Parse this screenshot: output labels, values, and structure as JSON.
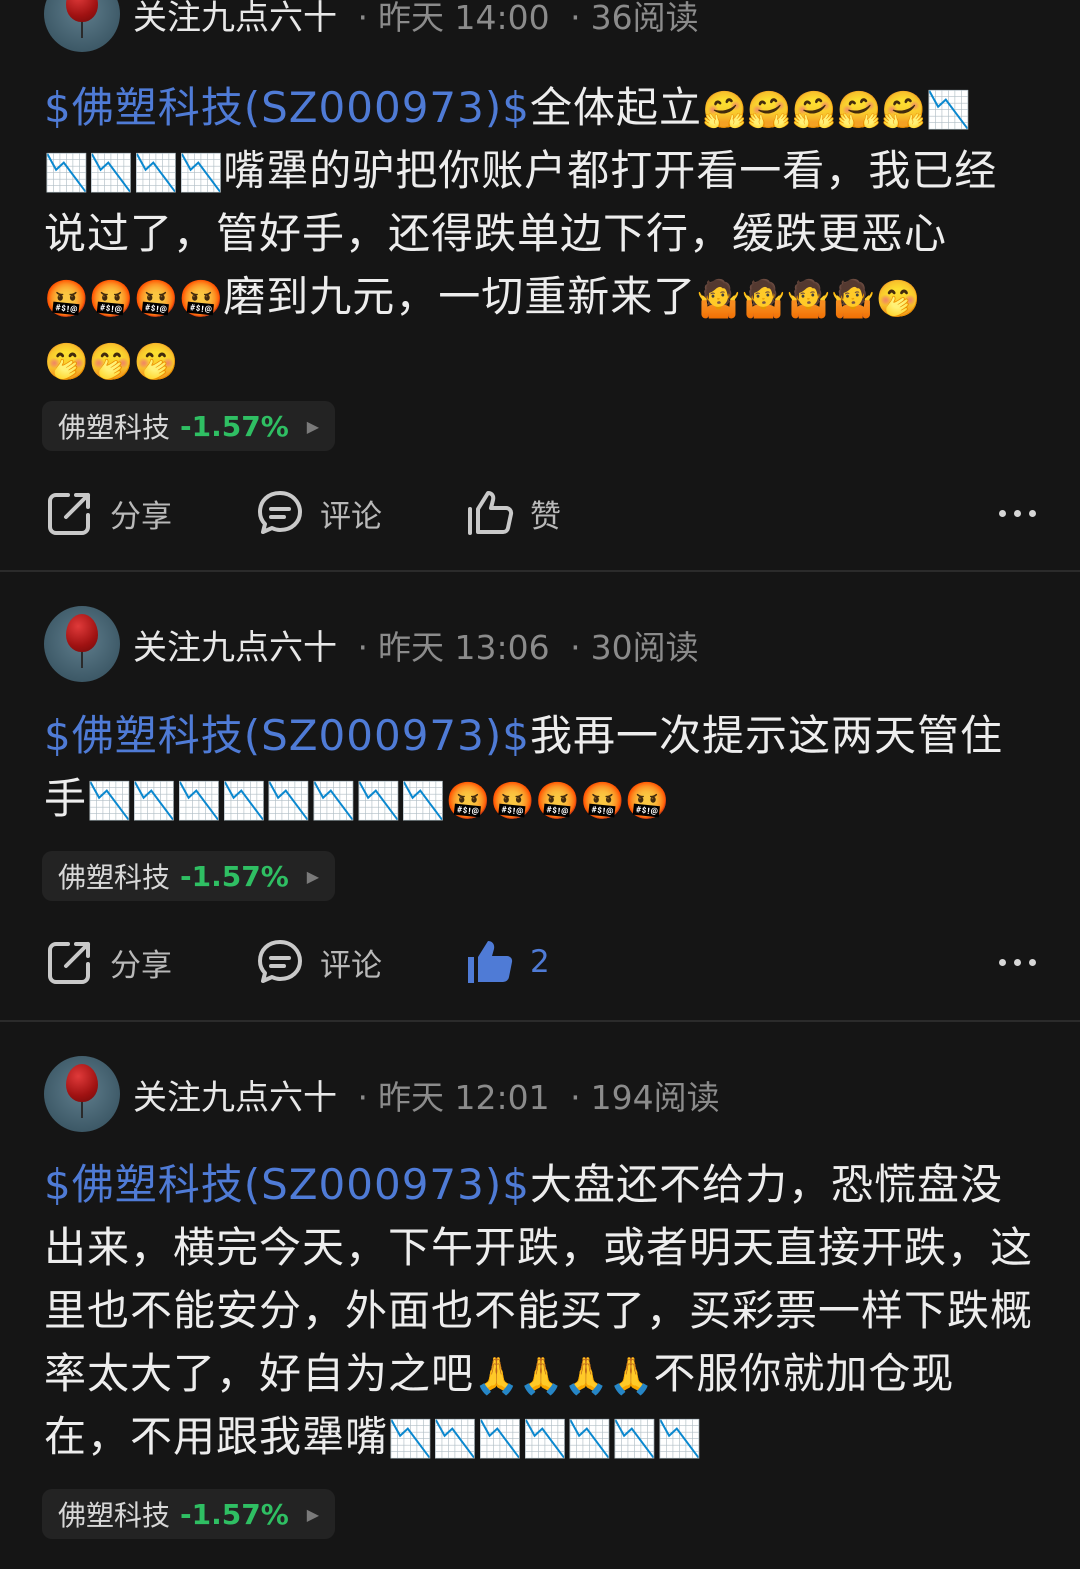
{
  "posts": [
    {
      "author": "关注九点六十",
      "time": "昨天 14:00",
      "reads": "36阅读",
      "stock_link": "$佛塑科技(SZ000973)$",
      "text_a": "全体起立",
      "emoji_a": "🤗🤗🤗🤗🤗",
      "emoji_b": "📉",
      "emoji_c": "📉📉📉📉",
      "text_b": "嘴犟的驴把你账户都打开看一看，我已经说过了，管好手，还得跌单边下行，缓跌更恶心",
      "emoji_d": "🤬🤬🤬🤬",
      "text_c": "磨到九元，一切重新来了",
      "emoji_e": "🤷🤷🤷🤷🤭",
      "emoji_f": "🤭🤭🤭",
      "stock_chip": {
        "name": "佛塑科技",
        "change": "-1.57%"
      },
      "actions": {
        "share": "分享",
        "comment": "评论",
        "like": "赞",
        "liked": false
      }
    },
    {
      "author": "关注九点六十",
      "time": "昨天 13:06",
      "reads": "30阅读",
      "stock_link": "$佛塑科技(SZ000973)$",
      "text_a": "我再一次提示这两天管住手",
      "emoji_a": "📉📉📉📉📉📉📉📉",
      "emoji_b": "🤬🤬🤬🤬🤬",
      "stock_chip": {
        "name": "佛塑科技",
        "change": "-1.57%"
      },
      "actions": {
        "share": "分享",
        "comment": "评论",
        "like": "2",
        "liked": true
      }
    },
    {
      "author": "关注九点六十",
      "time": "昨天 12:01",
      "reads": "194阅读",
      "stock_link": "$佛塑科技(SZ000973)$",
      "text_a": "大盘还不给力，恐慌盘没出来，横完今天，下午开跌，或者明天直接开跌，这里也不能安分，外面也不能买了，买彩票一样下跌概率太大了，好自为之吧",
      "emoji_a": "🙏🙏🙏🙏",
      "text_b": "不服你就加仓现在，不用跟我犟嘴",
      "emoji_b": "📉📉📉📉📉📉📉",
      "stock_chip": {
        "name": "佛塑科技",
        "change": "-1.57%"
      }
    }
  ],
  "colors": {
    "background": "#151515",
    "link": "#4f7bd6",
    "down": "#2fbf63",
    "muted": "#8b8b8b"
  }
}
